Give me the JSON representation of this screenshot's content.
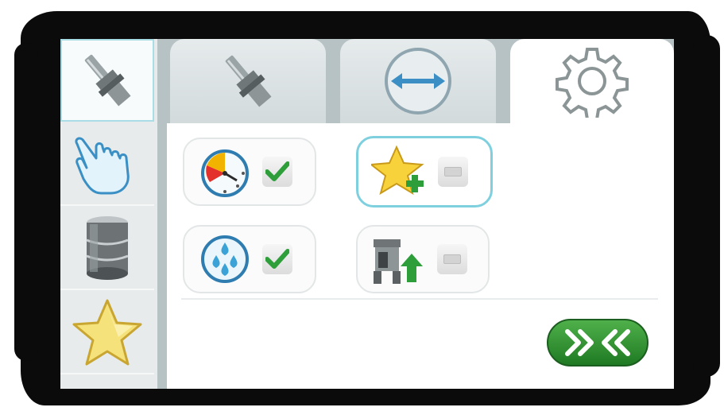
{
  "app": {
    "sidebar": {
      "items": [
        {
          "icon": "tool-holder-icon",
          "state": "active"
        },
        {
          "icon": "hand-pointer-icon",
          "state": "inactive"
        },
        {
          "icon": "database-icon",
          "state": "inactive"
        },
        {
          "icon": "star-icon",
          "state": "inactive"
        }
      ]
    },
    "tabs": [
      {
        "icon": "tool-holder-icon",
        "state": "inactive"
      },
      {
        "icon": "horizontal-arrows-icon",
        "state": "inactive"
      },
      {
        "icon": "gear-icon",
        "state": "active"
      }
    ],
    "options": [
      {
        "icon": "timer-icon",
        "checked": true
      },
      {
        "icon": "star-add-icon",
        "checked": false,
        "selected": true
      },
      {
        "icon": "coolant-drops-icon",
        "checked": true
      },
      {
        "icon": "machine-load-icon",
        "checked": false
      }
    ],
    "colors": {
      "accent_cyan": "#7fd0df",
      "check_green": "#2e9e3a",
      "go_green": "#2f8f33"
    }
  }
}
